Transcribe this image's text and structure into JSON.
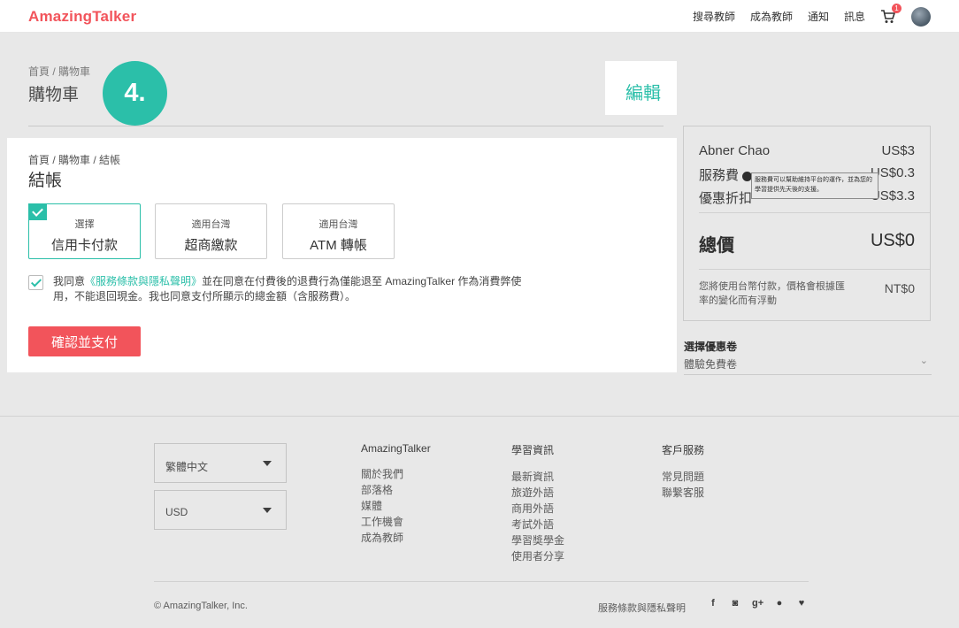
{
  "header": {
    "logo": "AmazingTalker",
    "nav": [
      "搜尋教師",
      "成為教師",
      "通知",
      "訊息"
    ],
    "cart_count": "1"
  },
  "background": {
    "breadcrumb": "首頁 / 購物車",
    "title": "購物車"
  },
  "step": {
    "number": "4."
  },
  "edit": {
    "label": "編輯"
  },
  "summary": {
    "teacher_name": "Abner Chao",
    "teacher_price": "US$3",
    "service_fee_label": "服務費",
    "service_fee": "US$0.3",
    "discount_label": "優惠折扣",
    "discount": "-US$3.3",
    "total_label": "總價",
    "total": "US$0",
    "note": "您將使用台幣付款，價格會根據匯率的變化而有浮動",
    "ntd": "NT$0",
    "tooltip": "服務費可以幫助維持平台的運作，並為您的學習提供先天後的支援。"
  },
  "coupon": {
    "label": "選擇優惠卷",
    "selected": "體驗免費卷"
  },
  "checkout": {
    "breadcrumb": "首頁 / 購物車 / 結帳",
    "title": "結帳",
    "options": [
      {
        "small": "選擇",
        "large": "信用卡付款"
      },
      {
        "small": "適用台灣",
        "large": "超商繳款"
      },
      {
        "small": "適用台灣",
        "large": "ATM 轉帳"
      }
    ],
    "agree_prefix": "我同意",
    "agree_link": "《服務條款與隱私聲明》",
    "agree_rest": "並在同意在付費後的退費行為僅能退至 AmazingTalker 作為消費弊使用，不能退回現金。我也同意支付所顯示的總金額（含服務費）。",
    "pay_button": "確認並支付"
  },
  "footer": {
    "language": "繁體中文",
    "currency": "USD",
    "col1": {
      "title": "AmazingTalker",
      "items": [
        "關於我們",
        "部落格",
        "媒體",
        "工作機會",
        "成為教師"
      ]
    },
    "col2": {
      "title": "學習資訊",
      "items": [
        "最新資訊",
        "旅遊外語",
        "商用外語",
        "考試外語",
        "學習獎學金",
        "使用者分享"
      ]
    },
    "col3": {
      "title": "客戶服務",
      "items": [
        "常見問題",
        "聯繫客服"
      ]
    },
    "copyright": "© AmazingTalker, Inc.",
    "terms": "服務條款與隱私聲明",
    "socials": [
      "f",
      "◙",
      "g+",
      "●",
      "♥"
    ]
  }
}
